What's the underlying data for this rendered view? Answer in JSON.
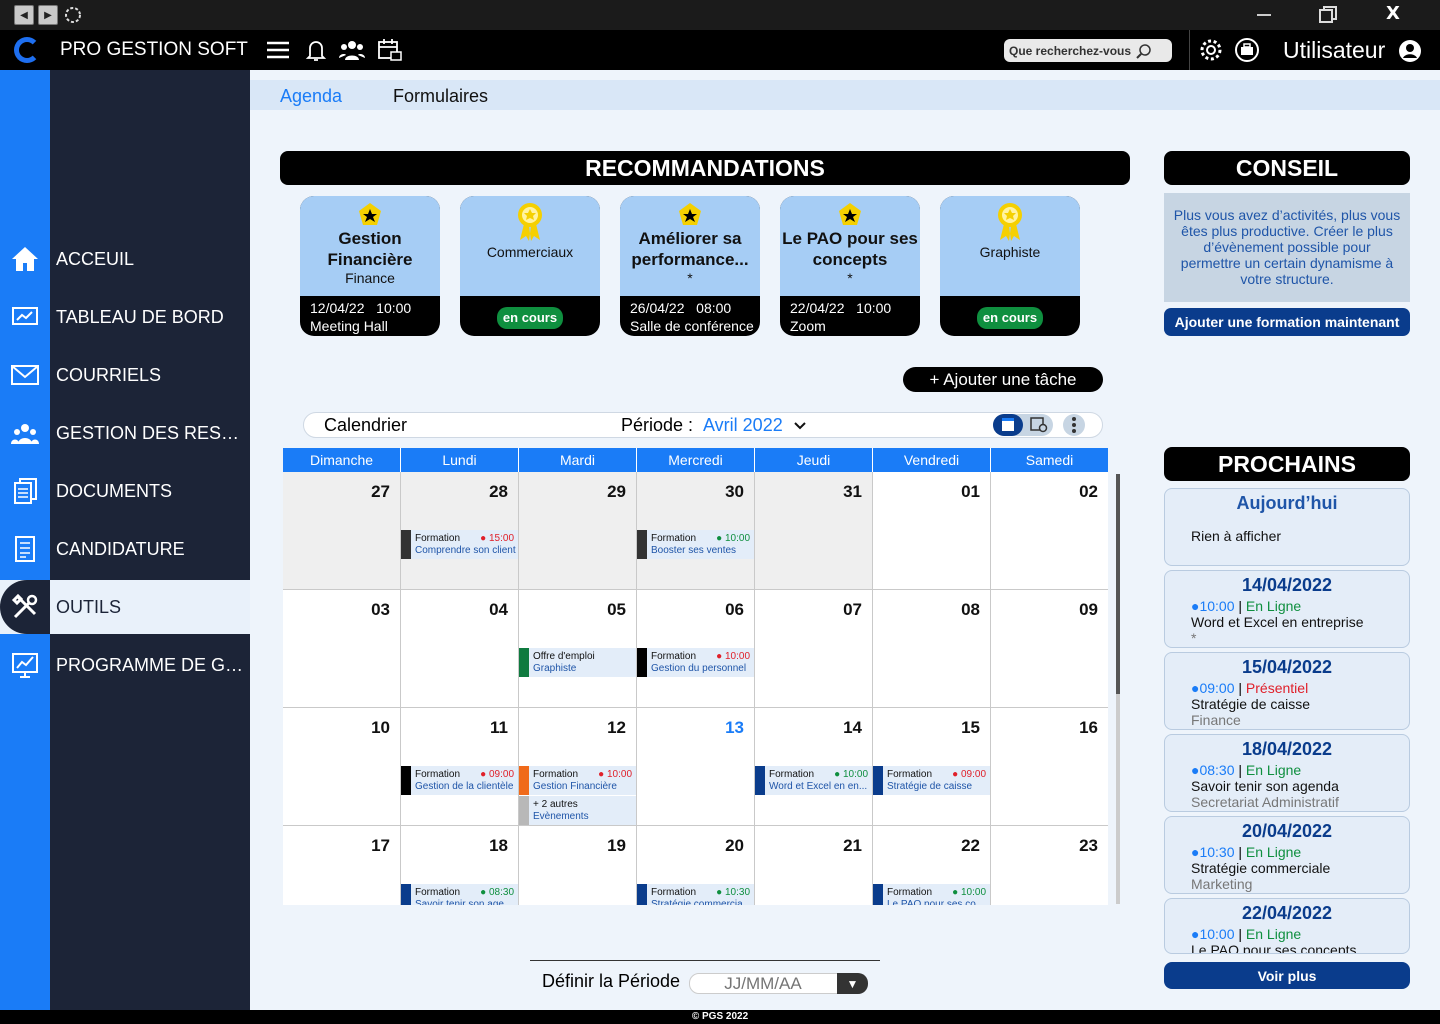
{
  "app": {
    "brand": "PRO GESTION SOFT",
    "close": "X",
    "user": "Utilisateur",
    "search_placeholder": "Que recherchez-vous",
    "footer": "© PGS 2022"
  },
  "sidebar": {
    "items": [
      {
        "label": "ACCEUIL",
        "icon": "home-icon"
      },
      {
        "label": "TABLEAU DE BORD",
        "icon": "dashboard-icon"
      },
      {
        "label": "COURRIELS",
        "icon": "mail-icon"
      },
      {
        "label": "GESTION DES RESSOURCES",
        "icon": "people-icon"
      },
      {
        "label": "DOCUMENTS",
        "icon": "documents-icon"
      },
      {
        "label": "CANDIDATURE",
        "icon": "candidature-icon"
      },
      {
        "label": "OUTILS",
        "icon": "tools-icon",
        "active": true
      },
      {
        "label": "PROGRAMME DE GESTION",
        "icon": "chart-icon"
      }
    ]
  },
  "tabs": [
    "Agenda",
    "Formulaires"
  ],
  "recommandations": {
    "title": "RECOMMANDATIONS",
    "cards": [
      {
        "title": "Gestion Financière",
        "sub": "Finance",
        "date": "12/04/22",
        "time": "10:00",
        "place": "Meeting Hall",
        "badge": "star-badge-icon"
      },
      {
        "title": "Commerciaux",
        "status": "en cours",
        "badge": "award-icon"
      },
      {
        "title": "Améliorer sa performance...",
        "sub": "*",
        "date": "26/04/22",
        "time": "08:00",
        "place": "Salle de conférence",
        "badge": "star-badge-icon"
      },
      {
        "title": "Le PAO pour ses concepts",
        "sub": "*",
        "date": "22/04/22",
        "time": "10:00",
        "place": "Zoom",
        "badge": "star-badge-icon"
      },
      {
        "title": "Graphiste",
        "status": "en cours",
        "badge": "award-icon"
      }
    ]
  },
  "add_task": "+ Ajouter une tâche",
  "calendar": {
    "label": "Calendrier",
    "period_label": "Période :",
    "period_value": "Avril 2022",
    "days": [
      "Dimanche",
      "Lundi",
      "Mardi",
      "Mercredi",
      "Jeudi",
      "Vendredi",
      "Samedi"
    ],
    "weeks": [
      [
        "27",
        "28",
        "29",
        "30",
        "31",
        "01",
        "02"
      ],
      [
        "03",
        "04",
        "05",
        "06",
        "07",
        "08",
        "09"
      ],
      [
        "10",
        "11",
        "12",
        "13",
        "14",
        "15",
        "16"
      ],
      [
        "17",
        "18",
        "19",
        "20",
        "21",
        "22",
        "23"
      ]
    ],
    "today": "13",
    "events": [
      {
        "w": 0,
        "d": 1,
        "type": "Formation",
        "time": "15:00",
        "title": "Comprendre son client",
        "bar": "#333333",
        "dot": "#e0202a"
      },
      {
        "w": 0,
        "d": 3,
        "type": "Formation",
        "time": "10:00",
        "title": "Booster ses ventes",
        "bar": "#333333",
        "dot": "#0f8f3f"
      },
      {
        "w": 1,
        "d": 2,
        "type": "Offre d'emploi",
        "time": "",
        "title": "Graphiste",
        "bar": "#0f7a3f",
        "dot": ""
      },
      {
        "w": 1,
        "d": 3,
        "type": "Formation",
        "time": "10:00",
        "title": "Gestion du personnel",
        "bar": "#000000",
        "dot": "#e0202a"
      },
      {
        "w": 2,
        "d": 1,
        "type": "Formation",
        "time": "09:00",
        "title": "Gestion de la clientèle",
        "bar": "#000000",
        "dot": "#e0202a"
      },
      {
        "w": 2,
        "d": 2,
        "type": "Formation",
        "time": "10:00",
        "title": "Gestion Financière",
        "bar": "#f06a1a",
        "dot": "#e0202a"
      },
      {
        "w": 2,
        "d": 2,
        "type": "+ 2 autres",
        "time": "",
        "title": "Evènements",
        "bar": "#b8b8b8",
        "dot": "",
        "second": true
      },
      {
        "w": 2,
        "d": 4,
        "type": "Formation",
        "time": "10:00",
        "title": "Word et Excel en en...",
        "bar": "#0a3c8c",
        "dot": "#0f8f3f"
      },
      {
        "w": 2,
        "d": 5,
        "type": "Formation",
        "time": "09:00",
        "title": "Stratégie de caisse",
        "bar": "#0a3c8c",
        "dot": "#e0202a"
      },
      {
        "w": 3,
        "d": 1,
        "type": "Formation",
        "time": "08:30",
        "title": "Savoir tenir son age...",
        "bar": "#0a3c8c",
        "dot": "#0f8f3f"
      },
      {
        "w": 3,
        "d": 3,
        "type": "Formation",
        "time": "10:30",
        "title": "Stratégie commercia...",
        "bar": "#0a3c8c",
        "dot": "#0f8f3f"
      },
      {
        "w": 3,
        "d": 5,
        "type": "Formation",
        "time": "10:00",
        "title": "Le PAO pour ses co...",
        "bar": "#0a3c8c",
        "dot": "#0f8f3f"
      }
    ]
  },
  "conseil": {
    "title": "CONSEIL",
    "text": "Plus vous avez d’activités, plus vous êtes plus productive. Créer le plus d’évènement possible pour permettre un certain dynamisme à votre structure.",
    "button": "Ajouter une formation maintenant"
  },
  "prochains": {
    "title": "PROCHAINS",
    "today_label": "Aujourd’hui",
    "today_empty": "Rien à afficher",
    "more": "Voir plus",
    "items": [
      {
        "date": "14/04/2022",
        "time": "10:00",
        "mode": "En Ligne",
        "mode_color": "#0f8f3f",
        "title": "Word et Excel en entreprise",
        "sub": "*"
      },
      {
        "date": "15/04/2022",
        "time": "09:00",
        "mode": "Présentiel",
        "mode_color": "#e0202a",
        "title": "Stratégie de caisse",
        "sub": "Finance"
      },
      {
        "date": "18/04/2022",
        "time": "08:30",
        "mode": "En Ligne",
        "mode_color": "#0f8f3f",
        "title": "Savoir tenir son agenda",
        "sub": "Secretariat Administratif"
      },
      {
        "date": "20/04/2022",
        "time": "10:30",
        "mode": "En Ligne",
        "mode_color": "#0f8f3f",
        "title": "Stratégie commerciale",
        "sub": "Marketing"
      },
      {
        "date": "22/04/2022",
        "time": "10:00",
        "mode": "En Ligne",
        "mode_color": "#0f8f3f",
        "title": "Le PAO pour ses concepts",
        "sub": ""
      }
    ]
  },
  "period_def": {
    "label": "Définir la Période",
    "placeholder": "JJ/MM/AA"
  },
  "colors": {
    "accent": "#1a7cf7",
    "navy": "#0a3c8c",
    "sidebar": "#1c2437",
    "green": "#0f8f3f",
    "red": "#e0202a"
  }
}
